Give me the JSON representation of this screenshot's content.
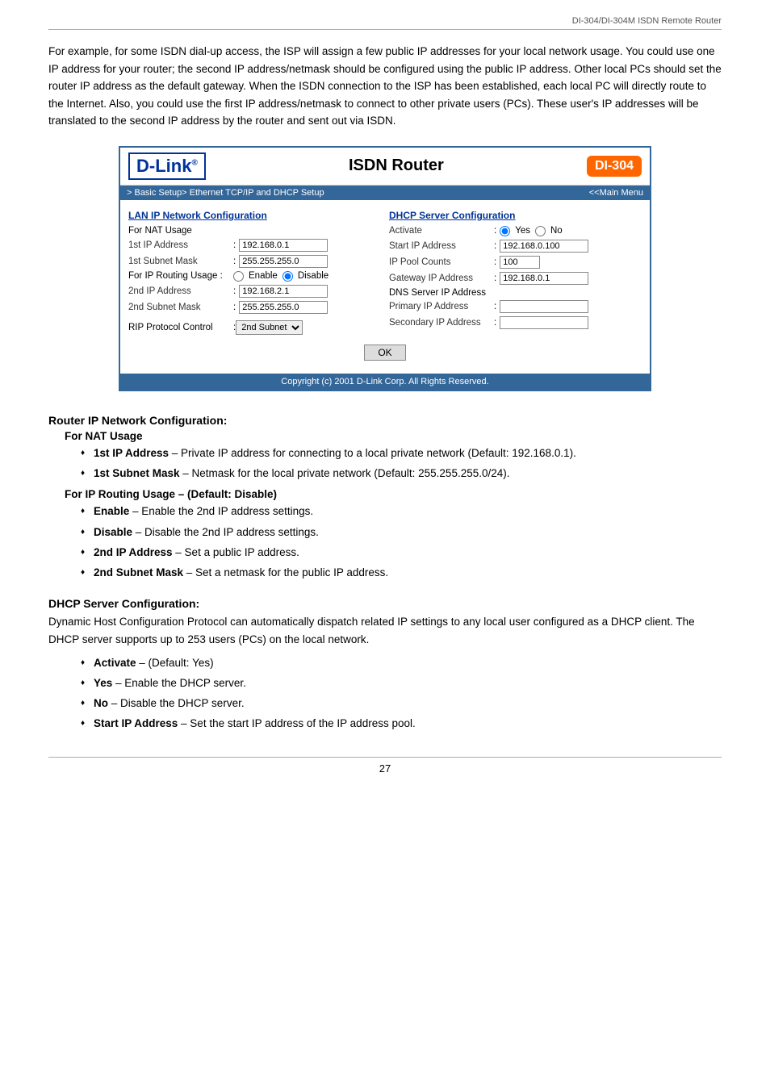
{
  "header": {
    "doc_title": "DI-304/DI-304M ISDN Remote Router"
  },
  "intro": {
    "text": "For example, for some ISDN dial-up access, the ISP will assign a few public IP addresses for your local network usage. You could use one IP address for your router; the second IP address/netmask should be configured using the public IP address. Other local PCs should set the router IP address as the default gateway. When the ISDN connection to the ISP has been established, each local PC will directly route to the Internet. Also, you could use the first IP address/netmask to connect to other private users (PCs). These user's IP addresses will be translated to the second IP address by the router and sent out via ISDN."
  },
  "router_ui": {
    "logo": "D-Link",
    "logo_tm": "®",
    "title": "ISDN Router",
    "badge": "DI-304",
    "nav_left": "> Basic Setup> Ethernet TCP/IP and DHCP Setup",
    "nav_right": "<<Main Menu",
    "lan_section_title": "LAN IP Network Configuration",
    "for_nat_usage": "For NAT Usage",
    "first_ip_label": "1st IP Address",
    "first_ip_value": "192.168.0.1",
    "first_mask_label": "1st Subnet Mask",
    "first_mask_value": "255.255.255.0",
    "for_ip_routing_label": "For IP Routing Usage :",
    "radio_enable": "Enable",
    "radio_disable": "Disable",
    "second_ip_label": "2nd IP Address",
    "second_ip_value": "192.168.2.1",
    "second_mask_label": "2nd Subnet Mask",
    "second_mask_value": "255.255.255.0",
    "rip_label": "RIP Protocol Control",
    "rip_value": "2nd Subnet",
    "dhcp_section_title": "DHCP Server Configuration",
    "activate_label": "Activate",
    "activate_yes": "Yes",
    "activate_no": "No",
    "start_ip_label": "Start IP Address",
    "start_ip_value": "192.168.0.100",
    "pool_counts_label": "IP Pool Counts",
    "pool_counts_value": "100",
    "gateway_label": "Gateway IP Address",
    "gateway_value": "192.168.0.1",
    "dns_section_label": "DNS Server IP Address",
    "primary_label": "Primary IP Address",
    "primary_value": "",
    "secondary_label": "Secondary IP Address",
    "secondary_value": "",
    "ok_button": "OK",
    "footer": "Copyright (c) 2001 D-Link Corp. All Rights Reserved."
  },
  "router_ip_section": {
    "title": "Router IP Network Configuration:",
    "nat_sub": "For NAT Usage",
    "bullets_nat": [
      {
        "bold": "1st IP Address",
        "text": " – Private IP address for connecting to a local private network (Default: 192.168.0.1)."
      },
      {
        "bold": "1st Subnet Mask",
        "text": " – Netmask for the local private network (Default: 255.255.255.0/24)."
      }
    ],
    "ip_routing_sub": "For IP Routing Usage –  (Default: Disable)",
    "bullets_ip": [
      {
        "bold": "Enable",
        "text": " – Enable the 2nd IP address settings."
      },
      {
        "bold": "Disable",
        "text": " – Disable the 2nd IP address settings."
      },
      {
        "bold": "2nd IP Address",
        "text": " – Set a public IP address."
      },
      {
        "bold": "2nd Subnet Mask",
        "text": " – Set a netmask for the public IP address."
      }
    ]
  },
  "dhcp_section": {
    "title": "DHCP Server Configuration:",
    "intro": "Dynamic Host Configuration Protocol can automatically dispatch related IP settings to any local user configured as a DHCP client. The DHCP server supports up to 253 users (PCs) on the local network.",
    "bullets": [
      {
        "bold": "Activate",
        "text": " –  (Default: Yes)"
      },
      {
        "bold": "Yes",
        "text": " – Enable the DHCP server."
      },
      {
        "bold": "No",
        "text": " – Disable the DHCP server."
      },
      {
        "bold": "Start IP Address",
        "text": " – Set the start IP address of the IP address pool."
      }
    ]
  },
  "page_number": "27"
}
